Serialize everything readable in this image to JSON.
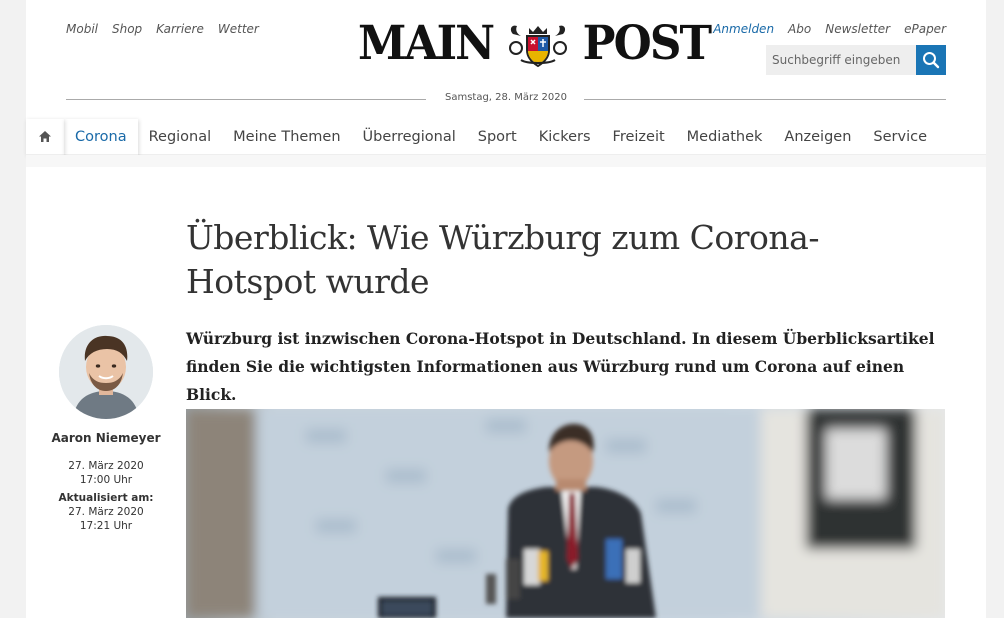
{
  "top_nav": [
    "Mobil",
    "Shop",
    "Karriere",
    "Wetter"
  ],
  "user_nav": [
    "Anmelden",
    "Abo",
    "Newsletter",
    "ePaper"
  ],
  "logo": {
    "left": "MAIN",
    "right": "POST"
  },
  "search": {
    "placeholder": "Suchbegriff eingeben",
    "icon": "search-icon"
  },
  "date": "Samstag, 28. März 2020",
  "main_nav": {
    "home_icon": "home-icon",
    "items": [
      "Corona",
      "Regional",
      "Meine Themen",
      "Überregional",
      "Sport",
      "Kickers",
      "Freizeit",
      "Mediathek",
      "Anzeigen",
      "Service"
    ],
    "active": "Corona"
  },
  "article": {
    "headline": "Überblick: Wie Würzburg zum Corona-Hotspot wurde",
    "lead": "Würzburg ist inzwischen Corona-Hotspot in Deutschland. In diesem Überblicksartikel finden Sie die wichtigsten Informationen aus Würzburg rund um Corona auf einen Blick.",
    "author": "Aaron Niemeyer",
    "published_date": "27. März 2020",
    "published_time": "17:00 Uhr",
    "updated_label": "Aktualisiert am:",
    "updated_date": "27. März 2020",
    "updated_time": "17:21 Uhr"
  },
  "colors": {
    "accent": "#1a75b5",
    "link": "#1a6aa8",
    "text": "#333333",
    "background": "#f2f2f2"
  }
}
